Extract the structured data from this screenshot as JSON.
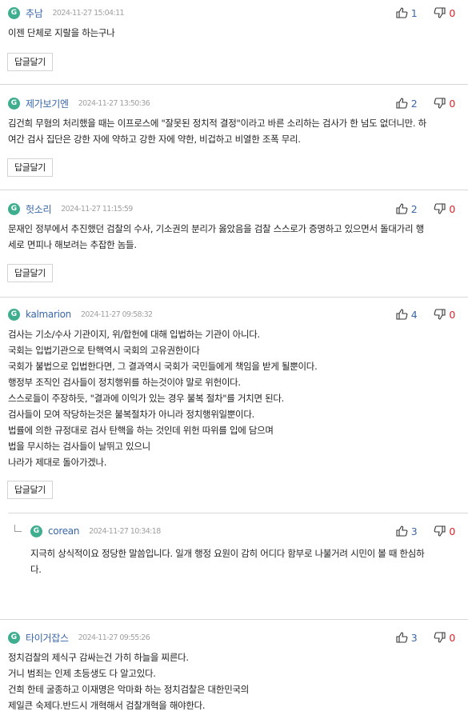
{
  "reply_button_label": "답글달기",
  "badge_letter": "G",
  "comments": [
    {
      "author": "추남",
      "date": "2024-11-27 15:04:11",
      "likes": "1",
      "dislikes": "0",
      "lines": [
        "이젠 단체로 지랄을 하는구나"
      ]
    },
    {
      "author": "제가보기엔",
      "date": "2024-11-27 13:50:36",
      "likes": "2",
      "dislikes": "0",
      "lines": [
        "김건희 무혐의 처리했을 때는 이프로스에 \"잘못된 정치적 결정\"이라고 바른 소리하는 검사가 한 넘도 없더니만. 하",
        "여간 검사 집단은 강한 자에 약하고 강한 자에 약한, 비겁하고 비열한 조폭 무리."
      ]
    },
    {
      "author": "헛소리",
      "date": "2024-11-27 11:15:59",
      "likes": "2",
      "dislikes": "0",
      "lines": [
        "문재인 정부에서 추진했던 검찰의 수사, 기소권의 분리가 옳았음을 검찰 스스로가 증명하고 있으면서 돌대가리 행",
        "세로 면피나 해보려는 추잡한 놈들."
      ]
    },
    {
      "author": "kalmarion",
      "date": "2024-11-27 09:58:32",
      "likes": "4",
      "dislikes": "0",
      "lines": [
        "검사는 기소/수사 기관이지, 위/합헌에 대해 입법하는 기관이 아니다.",
        "국회는 입법기관으로 탄핵역시 국회의 고유권한이다",
        "국회가 불법으로 입법한다면, 그 결과역시 국회가 국민들에게 책임을 받게 될뿐이다.",
        "행정부 조직인 검사들이 정치행위를 하는것이야 말로 위헌이다.",
        "스스로들이 주장하듯, \"결과에 이익가 있는 경우 불복 절차\"를 거치면 된다.",
        "검사들이 모여 작당하는것은 불복절차가 아니라 정치행위일뿐이다.",
        "법률에 의한 규정대로 검사 탄핵을 하는 것인데 위헌 따위를 입에 담으며",
        "법을 무시하는 검사들이 날뛰고 있으니",
        "나라가 제대로 돌아가겠나."
      ]
    },
    {
      "author": "corean",
      "date": "2024-11-27 10:34:18",
      "likes": "3",
      "dislikes": "0",
      "lines": [
        "지극히 상식적이요 정당한 말씀입니다. 일개 행정 요원이 감히 어디다 함부로 나불거려 시민이 볼 때 한심하",
        "다."
      ]
    },
    {
      "author": "타이거잡스",
      "date": "2024-11-27 09:55:26",
      "likes": "3",
      "dislikes": "0",
      "lines": [
        "정치검찰의 제식구 감싸는건 가히 하늘을 찌른다.",
        "거니 범죄는 인제 초등생도 다 알고있다.",
        "건희 한테 굴종하고 이재명은 악마화 하는 정치검찰은 대한민국의",
        "제일큰 숙제다.반드시 개혁해서 검찰개혁을 해야한다."
      ]
    }
  ]
}
